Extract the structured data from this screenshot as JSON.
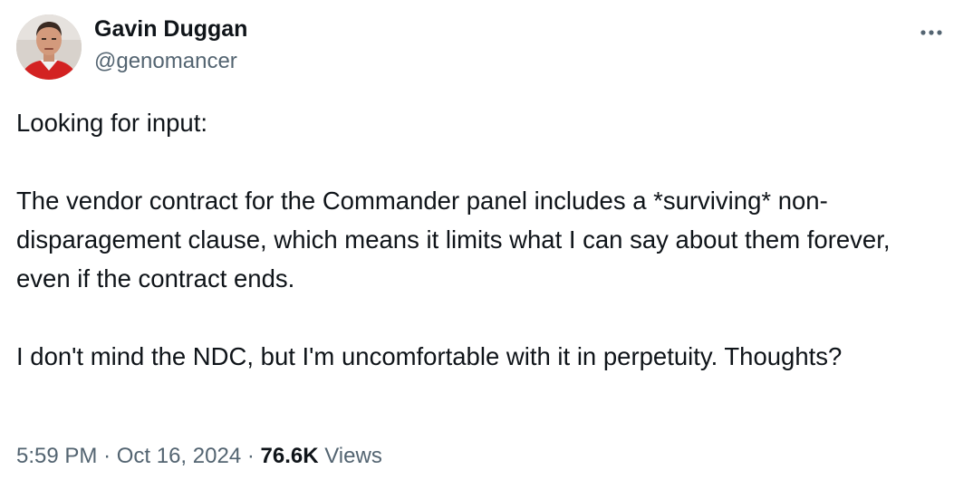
{
  "author": {
    "display_name": "Gavin Duggan",
    "handle": "@genomancer"
  },
  "tweet": {
    "paragraphs": [
      "Looking for input:",
      "The vendor contract for the Commander panel includes a *surviving* non-disparagement clause, which means it limits what I can say about them forever, even if the contract ends.",
      "I don't mind the NDC, but I'm uncomfortable with it in perpetuity. Thoughts?"
    ]
  },
  "meta": {
    "time": "5:59 PM",
    "separator_1": "·",
    "date": "Oct 16, 2024",
    "separator_2": "·",
    "views_count": "76.6K",
    "views_label": "Views"
  },
  "icons": {
    "more": "more-horizontal-icon"
  },
  "colors": {
    "text_primary": "#0f1419",
    "text_secondary": "#536471"
  }
}
